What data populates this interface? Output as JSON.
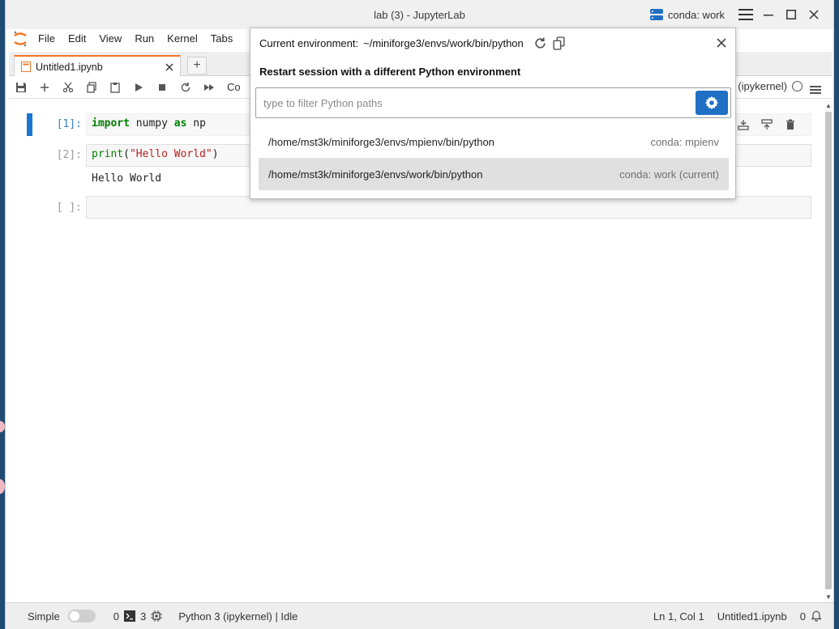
{
  "window": {
    "title": "lab (3) - JupyterLab",
    "env_chip": "conda: work"
  },
  "menubar": [
    "File",
    "Edit",
    "View",
    "Run",
    "Kernel",
    "Tabs"
  ],
  "tabs": [
    {
      "label": "Untitled1.ipynb"
    }
  ],
  "toolbar": {
    "cell_type_partial": "Co",
    "kernel_partial": "3 (ipykernel)"
  },
  "cells": [
    {
      "prompt": "[1]:",
      "tokens": [
        [
          "kw",
          "import"
        ],
        [
          "plain",
          " numpy "
        ],
        [
          "kw",
          "as"
        ],
        [
          "plain",
          " np"
        ]
      ],
      "output": ""
    },
    {
      "prompt": "[2]:",
      "tokens": [
        [
          "fn",
          "print"
        ],
        [
          "plain",
          "("
        ],
        [
          "str",
          "\"Hello World\""
        ],
        [
          "plain",
          ")"
        ]
      ],
      "output": "Hello World"
    },
    {
      "prompt": "[ ]:",
      "tokens": [],
      "output": ""
    }
  ],
  "popup": {
    "current_label": "Current environment:",
    "current_path": "~/miniforge3/envs/work/bin/python",
    "heading": "Restart session with a different Python environment",
    "filter_placeholder": "type to filter Python paths",
    "environments": [
      {
        "path": "/home/mst3k/miniforge3/envs/mpienv/bin/python",
        "tag": "conda: mpienv",
        "selected": false
      },
      {
        "path": "/home/mst3k/miniforge3/envs/work/bin/python",
        "tag": "conda: work (current)",
        "selected": true
      }
    ]
  },
  "statusbar": {
    "mode": "Simple",
    "terminals": "0",
    "kernels": "3",
    "kernel": "Python 3 (ipykernel) | Idle",
    "cursor": "Ln 1, Col 1",
    "file": "Untitled1.ipynb",
    "notifications": "0"
  },
  "colors": {
    "accent": "#1f6fc3",
    "active_cell": "#1976d2",
    "tab_top": "#f37726"
  }
}
